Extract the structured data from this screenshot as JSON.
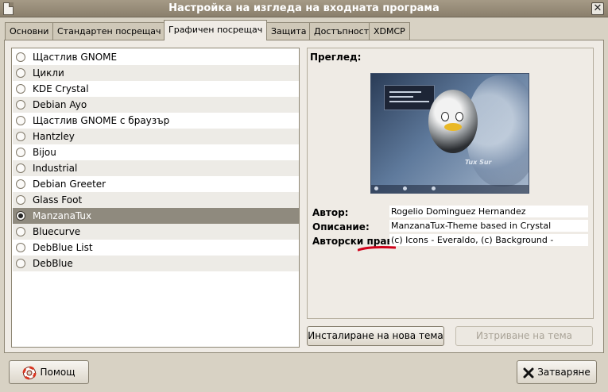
{
  "window": {
    "title": "Настройка на изгледа на входната програма",
    "close_glyph": "✕"
  },
  "tabs": [
    {
      "label": "Основни",
      "active": false
    },
    {
      "label": "Стандартен посрещач",
      "active": false
    },
    {
      "label": "Графичен посрещач",
      "active": true
    },
    {
      "label": "Защита",
      "active": false
    },
    {
      "label": "Достъпност",
      "active": false
    },
    {
      "label": "XDMCP",
      "active": false
    }
  ],
  "themes": {
    "items": [
      {
        "label": "Щастлив GNOME",
        "selected": false
      },
      {
        "label": "Цикли",
        "selected": false
      },
      {
        "label": "KDE Crystal",
        "selected": false
      },
      {
        "label": "Debian Ayo",
        "selected": false
      },
      {
        "label": "Щастлив GNOME с браузър",
        "selected": false
      },
      {
        "label": "Hantzley",
        "selected": false
      },
      {
        "label": "Bijou",
        "selected": false
      },
      {
        "label": "Industrial",
        "selected": false
      },
      {
        "label": "Debian Greeter",
        "selected": false
      },
      {
        "label": "Glass Foot",
        "selected": false
      },
      {
        "label": "ManzanaTux",
        "selected": true
      },
      {
        "label": "Bluecurve",
        "selected": false
      },
      {
        "label": "DebBlue List",
        "selected": false
      },
      {
        "label": "DebBlue",
        "selected": false
      }
    ]
  },
  "preview": {
    "heading": "Преглед:",
    "thumbnail_brand": "Tux Sur",
    "fields": {
      "author_label": "Автор:",
      "author_value": "Rogelio Dominguez Hernandez",
      "description_label": "Описание:",
      "description_value": "ManzanaTux-Theme based in Crystal",
      "copyright_label": "Авторски прав",
      "copyright_value": "(c) Icons - Everaldo, (c) Background -"
    },
    "underline_color": "#d0021b"
  },
  "buttons": {
    "install_theme": "Инсталиране на нова тема",
    "delete_theme": "Изтриване на тема",
    "help": "Помощ",
    "close": "Затваряне"
  }
}
